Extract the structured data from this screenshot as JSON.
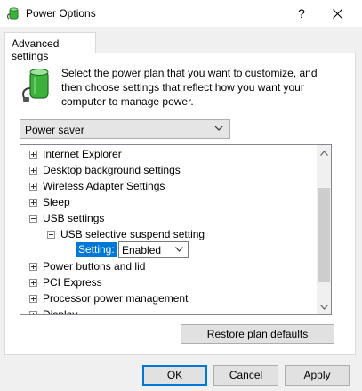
{
  "window": {
    "title": "Power Options",
    "help_glyph": "?",
    "app_icon": "power-options-battery-icon",
    "close_icon": "close-icon"
  },
  "tab": {
    "label": "Advanced settings"
  },
  "intro": {
    "text": "Select the power plan that you want to customize, and then choose settings that reflect how you want your computer to manage power.",
    "icon": "battery-plug-icon"
  },
  "plan_select": {
    "selected": "Power saver"
  },
  "tree": {
    "items": [
      {
        "label": "Internet Explorer",
        "state": "collapsed"
      },
      {
        "label": "Desktop background settings",
        "state": "collapsed"
      },
      {
        "label": "Wireless Adapter Settings",
        "state": "collapsed"
      },
      {
        "label": "Sleep",
        "state": "collapsed"
      },
      {
        "label": "USB settings",
        "state": "expanded"
      },
      {
        "label": "USB selective suspend setting",
        "state": "expanded"
      },
      {
        "label": "Power buttons and lid",
        "state": "collapsed"
      },
      {
        "label": "PCI Express",
        "state": "collapsed"
      },
      {
        "label": "Processor power management",
        "state": "collapsed"
      },
      {
        "label": "Display",
        "state": "collapsed"
      }
    ],
    "setting": {
      "label": "Setting:",
      "value": "Enabled"
    }
  },
  "buttons": {
    "restore": "Restore plan defaults",
    "ok": "OK",
    "cancel": "Cancel",
    "apply": "Apply"
  },
  "colors": {
    "accent": "#0078d7",
    "battery_green": "#3cb13c"
  }
}
